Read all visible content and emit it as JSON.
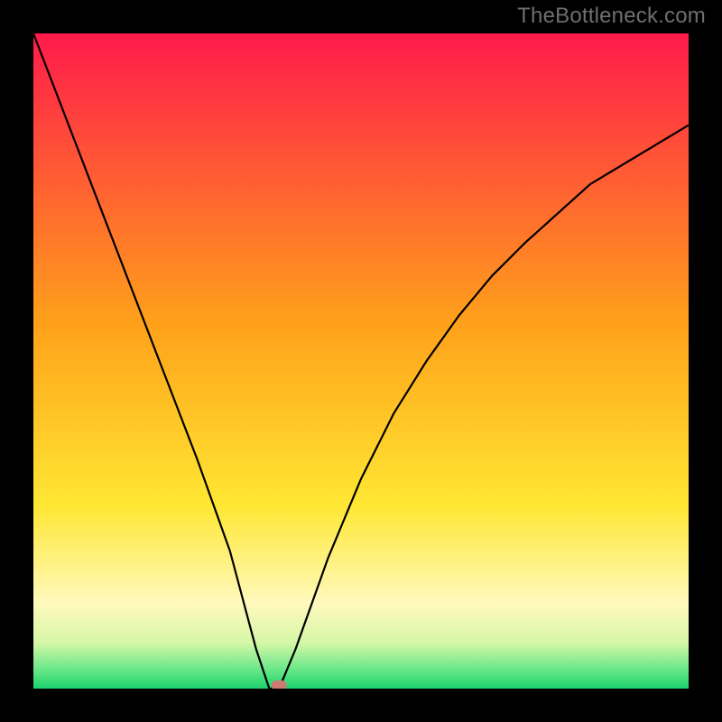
{
  "attribution": "TheBottleneck.com",
  "chart_data": {
    "type": "line",
    "title": "",
    "xlabel": "",
    "ylabel": "",
    "xlim": [
      0,
      100
    ],
    "ylim": [
      0,
      100
    ],
    "x": [
      0,
      5,
      10,
      15,
      20,
      25,
      30,
      34,
      36,
      37.5,
      40,
      45,
      50,
      55,
      60,
      65,
      70,
      75,
      80,
      85,
      90,
      95,
      100
    ],
    "values": [
      100,
      87,
      74,
      61,
      48,
      35,
      21,
      6,
      0,
      0,
      6,
      20,
      32,
      42,
      50,
      57,
      63,
      68,
      72.5,
      77,
      80,
      83,
      86
    ],
    "marker": {
      "x": 37.5,
      "y": 0
    },
    "gradient_stops": [
      {
        "offset": 0.0,
        "color": "#ff1a4b"
      },
      {
        "offset": 0.45,
        "color": "#ffa31a"
      },
      {
        "offset": 0.72,
        "color": "#ffe733"
      },
      {
        "offset": 0.87,
        "color": "#fff9bd"
      },
      {
        "offset": 0.93,
        "color": "#d6f7a7"
      },
      {
        "offset": 0.97,
        "color": "#6be889"
      },
      {
        "offset": 1.0,
        "color": "#1dd26d"
      }
    ]
  }
}
